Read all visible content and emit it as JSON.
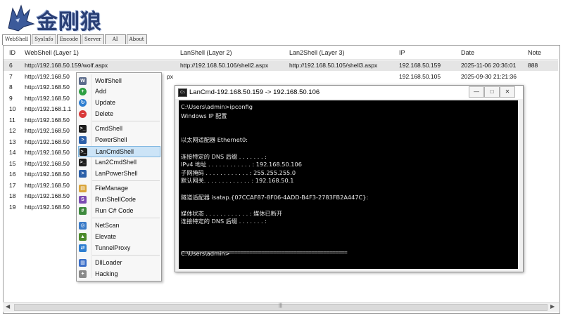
{
  "app": {
    "logo_text": "金刚狼",
    "tabs": [
      "WebShell",
      "SysInfo",
      "Encode",
      "Server",
      "AI",
      "About"
    ],
    "active_tab": "WebShell"
  },
  "grid": {
    "columns": [
      "ID",
      "WebShell (Layer 1)",
      "LanShell (Layer 2)",
      "Lan2Shell (Layer 3)",
      "IP",
      "Date",
      "Note"
    ],
    "rows": [
      {
        "id": "6",
        "webshell": "http://192.168.50.159/wolf.aspx",
        "lan": "http://192.168.50.106/shell2.aspx",
        "lan2": "http://192.168.50.105/shell3.aspx",
        "ip": "192.168.50.159",
        "date": "2025-11-06 20:36:01",
        "note": "888"
      },
      {
        "id": "7",
        "webshell": "http://192.168.50",
        "lan": "px",
        "lan2": "",
        "ip": "192.168.50.105",
        "date": "2025-09-30 21:21:36",
        "note": ""
      },
      {
        "id": "8",
        "webshell": "http://192.168.50",
        "lan": "",
        "lan2": "",
        "ip": "",
        "date": "",
        "note": ""
      },
      {
        "id": "9",
        "webshell": "http://192.168.50",
        "lan": "",
        "lan2": "",
        "ip": "",
        "date": "",
        "note": ""
      },
      {
        "id": "10",
        "webshell": "http://192.168.1.1",
        "lan": "",
        "lan2": "",
        "ip": "",
        "date": "",
        "note": ""
      },
      {
        "id": "11",
        "webshell": "http://192.168.50",
        "lan": "",
        "lan2": "",
        "ip": "",
        "date": "",
        "note": ""
      },
      {
        "id": "12",
        "webshell": "http://192.168.50",
        "lan": "",
        "lan2": "",
        "ip": "",
        "date": "",
        "note": ""
      },
      {
        "id": "13",
        "webshell": "http://192.168.50",
        "lan": "",
        "lan2": "",
        "ip": "",
        "date": "",
        "note": ""
      },
      {
        "id": "14",
        "webshell": "http://192.168.50",
        "lan": "",
        "lan2": "",
        "ip": "",
        "date": "",
        "note": ""
      },
      {
        "id": "15",
        "webshell": "http://192.168.50",
        "lan": "",
        "lan2": "",
        "ip": "",
        "date": "",
        "note": ""
      },
      {
        "id": "16",
        "webshell": "http://192.168.50",
        "lan": "",
        "lan2": "",
        "ip": "",
        "date": "",
        "note": ""
      },
      {
        "id": "17",
        "webshell": "http://192.168.50",
        "lan": "",
        "lan2": "",
        "ip": "",
        "date": "",
        "note": ""
      },
      {
        "id": "18",
        "webshell": "http://192.168.50",
        "lan": "",
        "lan2": "",
        "ip": "",
        "date": "",
        "note": ""
      },
      {
        "id": "19",
        "webshell": "http://192.168.50",
        "lan": "",
        "lan2": "",
        "ip": "",
        "date": "",
        "note": ""
      }
    ]
  },
  "context_menu": {
    "items": [
      {
        "label": "WolfShell",
        "icon": "wolf-icon",
        "color": "#5a6a8a"
      },
      {
        "label": "Add",
        "icon": "add-icon",
        "color": "#2ea043"
      },
      {
        "label": "Update",
        "icon": "update-icon",
        "color": "#2f7fd1"
      },
      {
        "label": "Delete",
        "icon": "delete-icon",
        "color": "#d93a3a"
      },
      {
        "label": "CmdShell",
        "icon": "cmd-icon",
        "color": "#1c1c1c"
      },
      {
        "label": "PowerShell",
        "icon": "powershell-icon",
        "color": "#2b5fa8"
      },
      {
        "label": "LanCmdShell",
        "icon": "lancmd-icon",
        "color": "#1c1c1c"
      },
      {
        "label": "Lan2CmdShell",
        "icon": "lan2cmd-icon",
        "color": "#1c1c1c"
      },
      {
        "label": "LanPowerShell",
        "icon": "lanpowershell-icon",
        "color": "#2b5fa8"
      },
      {
        "label": "FileManage",
        "icon": "folder-icon",
        "color": "#d9a43a"
      },
      {
        "label": "RunShellCode",
        "icon": "shellcode-icon",
        "color": "#7b4bb3"
      },
      {
        "label": "Run C# Code",
        "icon": "csharp-icon",
        "color": "#3d8a3d"
      },
      {
        "label": "NetScan",
        "icon": "netscan-icon",
        "color": "#3a7bc8"
      },
      {
        "label": "Elevate",
        "icon": "elevate-icon",
        "color": "#4b8a2a"
      },
      {
        "label": "TunnelProxy",
        "icon": "tunnel-icon",
        "color": "#2f7fd1"
      },
      {
        "label": "DllLoader",
        "icon": "dll-icon",
        "color": "#3a6ec8"
      },
      {
        "label": "Hacking",
        "icon": "hacking-icon",
        "color": "#8a8a8a"
      }
    ],
    "highlighted": "LanCmdShell"
  },
  "console_window": {
    "title": "LanCmd-192.168.50.159 -> 192.168.50.106",
    "lines": [
      "C:\\Users\\admin>ipconfig",
      "Windows IP 配置",
      "",
      "",
      "以太网适配器 Ethernet0:",
      "",
      "   连接特定的 DNS 后缀 . . . . . . . :",
      "   IPv4 地址 . . . . . . . . . . . . : 192.168.50.106",
      "   子网掩码  . . . . . . . . . . . . : 255.255.255.0",
      "   默认网关. . . . . . . . . . . . . : 192.168.50.1",
      "",
      "隧道适配器 isatap.{07CCAF87-8F06-4ADD-B4F3-2783FB2A447C}:",
      "",
      "   媒体状态  . . . . . . . . . . . . : 媒体已断开",
      "   连接特定的 DNS 后缀 . . . . . . . :",
      "",
      "",
      "C:\\Users\\admin>"
    ],
    "divider": "========================================================"
  },
  "colors": {
    "console_bg": "#000000",
    "menu_highlight": "#cce4f7",
    "selected_row": "#e5e5e5",
    "logo_blue": "#2a3f75"
  }
}
